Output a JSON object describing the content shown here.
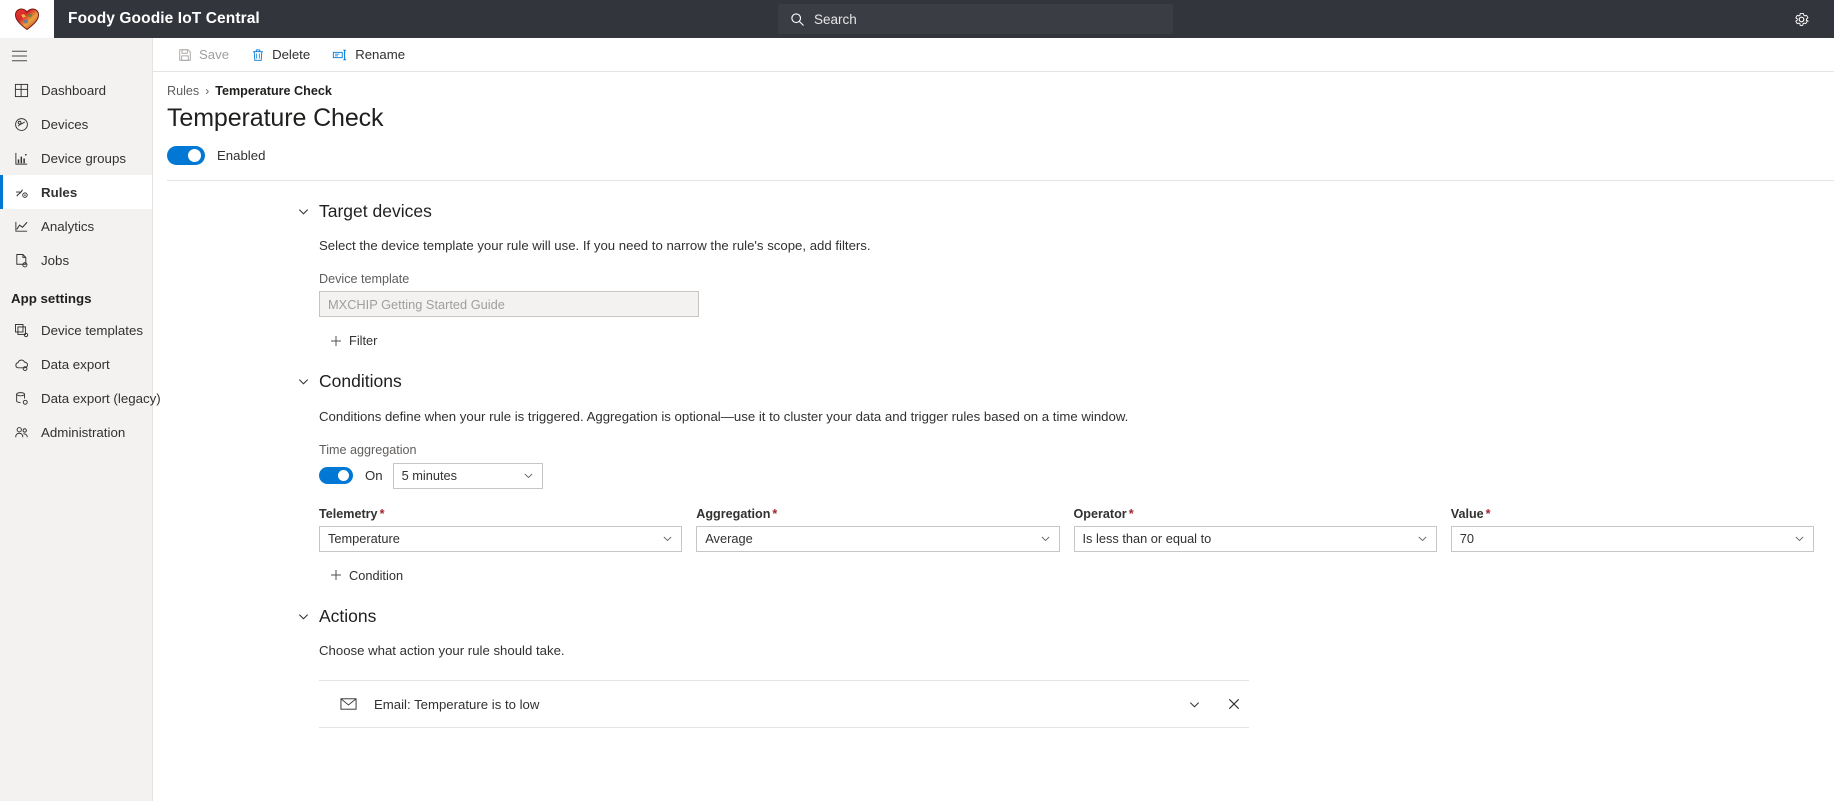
{
  "topbar": {
    "brand_title": "Foody Goodie IoT Central",
    "logo_icon": "heart-logo-icon",
    "search_placeholder": "Search",
    "search_icon": "search-icon",
    "settings_icon": "gear-icon"
  },
  "sidebar": {
    "menu_icon": "hamburger-menu-icon",
    "items": [
      {
        "label": "Dashboard",
        "icon": "dashboard-grid-icon",
        "active": false
      },
      {
        "label": "Devices",
        "icon": "devices-chip-icon",
        "active": false
      },
      {
        "label": "Device groups",
        "icon": "device-groups-chart-icon",
        "active": false
      },
      {
        "label": "Rules",
        "icon": "rules-flow-icon",
        "active": true
      },
      {
        "label": "Analytics",
        "icon": "analytics-line-icon",
        "active": false
      },
      {
        "label": "Jobs",
        "icon": "jobs-document-icon",
        "active": false
      }
    ],
    "section_title": "App settings",
    "settings_items": [
      {
        "label": "Device templates",
        "icon": "device-templates-stack-icon"
      },
      {
        "label": "Data export",
        "icon": "data-export-cloud-icon"
      },
      {
        "label": "Data export (legacy)",
        "icon": "data-export-database-icon"
      },
      {
        "label": "Administration",
        "icon": "administration-people-icon"
      }
    ]
  },
  "command_bar": {
    "save": {
      "label": "Save",
      "icon": "save-disk-icon",
      "disabled": true
    },
    "delete": {
      "label": "Delete",
      "icon": "delete-trash-icon",
      "disabled": false
    },
    "rename": {
      "label": "Rename",
      "icon": "rename-tag-icon",
      "disabled": false
    }
  },
  "page": {
    "breadcrumb_parent": "Rules",
    "breadcrumb_separator": "›",
    "breadcrumb_current": "Temperature Check",
    "title": "Temperature Check",
    "enabled_label": "Enabled",
    "enabled_state": true
  },
  "target_devices": {
    "title": "Target devices",
    "chevron_icon": "chevron-down-icon",
    "description": "Select the device template your rule will use. If you need to narrow the rule's scope, add filters.",
    "device_template_label": "Device template",
    "device_template_value": "MXCHIP Getting Started Guide",
    "device_template_disabled": true,
    "add_filter_label": "Filter",
    "add_filter_icon": "plus-icon"
  },
  "conditions": {
    "title": "Conditions",
    "chevron_icon": "chevron-down-icon",
    "description": "Conditions define when your rule is triggered. Aggregation is optional—use it to cluster your data and trigger rules based on a time window.",
    "time_aggregation_label": "Time aggregation",
    "time_aggregation_state": "On",
    "time_aggregation_enabled": true,
    "time_window_value": "5 minutes",
    "fields": [
      {
        "label": "Telemetry",
        "required": true,
        "value": "Temperature",
        "name": "telemetry-select"
      },
      {
        "label": "Aggregation",
        "required": true,
        "value": "Average",
        "name": "aggregation-select"
      },
      {
        "label": "Operator",
        "required": true,
        "value": "Is less than or equal to",
        "name": "operator-select"
      },
      {
        "label": "Value",
        "required": true,
        "value": "70",
        "name": "value-select"
      }
    ],
    "required_marker": "*",
    "add_condition_label": "Condition",
    "add_condition_icon": "plus-icon"
  },
  "actions": {
    "title": "Actions",
    "chevron_icon": "chevron-down-icon",
    "description": "Choose what action your rule should take.",
    "items": [
      {
        "label": "Email: Temperature is to low",
        "icon": "email-envelope-icon",
        "expand_icon": "chevron-down-icon",
        "remove_icon": "close-x-icon"
      }
    ]
  },
  "colors": {
    "accent": "#0078d4",
    "topbar_bg": "#33353c",
    "sidebar_bg": "#f3f2f1",
    "required_star": "#a4262c"
  }
}
